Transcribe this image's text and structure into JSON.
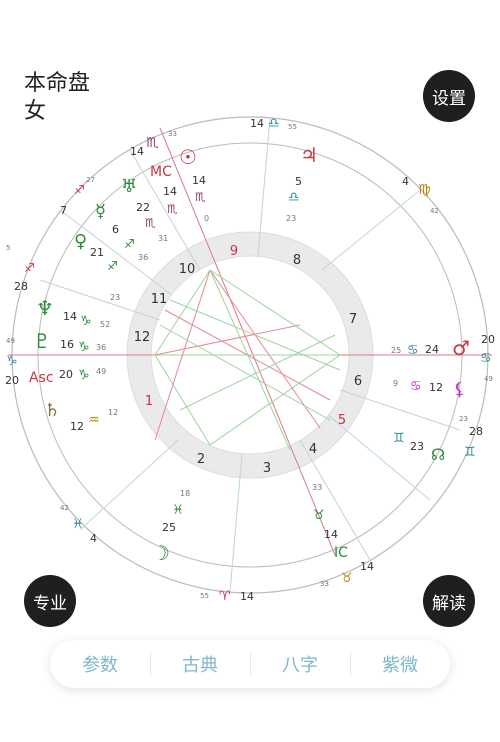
{
  "header": {
    "title": "本命盘",
    "gender": "女",
    "settings_label": "设置"
  },
  "footer_buttons": {
    "pro_label": "专业",
    "interpret_label": "解读"
  },
  "tabs": [
    "参数",
    "古典",
    "八字",
    "紫微"
  ],
  "houses": [
    "1",
    "2",
    "3",
    "4",
    "5",
    "6",
    "7",
    "8",
    "9",
    "10",
    "11",
    "12"
  ],
  "cusp_labels": [
    {
      "deg": "14",
      "min": "55",
      "sign": "♎"
    },
    {
      "deg": "4",
      "min": "42",
      "sign": "♍"
    },
    {
      "deg": "20",
      "min": "49",
      "sign": "♋"
    },
    {
      "deg": "28",
      "min": "23",
      "sign": "♊"
    },
    {
      "deg": "14",
      "min": "33",
      "sign": "♉"
    },
    {
      "deg": "14",
      "min": "55",
      "sign": "♈"
    },
    {
      "deg": "4",
      "min": "42",
      "sign": "♓"
    },
    {
      "deg": "20",
      "min": "49",
      "sign": "♑"
    },
    {
      "deg": "28",
      "min": "5",
      "sign": "♐"
    },
    {
      "deg": "14",
      "min": "27",
      "sign": "♐"
    },
    {
      "deg": "7",
      "min": "",
      "sign": ""
    },
    {
      "deg": "14",
      "min": "33",
      "sign": "♏"
    }
  ],
  "planets": [
    {
      "glyph": "☉",
      "deg": "14",
      "sign": "♏",
      "min": "0",
      "color": "#cc3344"
    },
    {
      "glyph": "MC",
      "deg": "14",
      "sign": "♏",
      "min": "33",
      "color": "#cc3344"
    },
    {
      "glyph": "♃",
      "deg": "5",
      "sign": "♎",
      "min": "23",
      "color": "#cc3344"
    },
    {
      "glyph": "♅",
      "deg": "22",
      "sign": "♏",
      "min": "31",
      "color": "#2a8a3a"
    },
    {
      "glyph": "☿",
      "deg": "6",
      "sign": "♐",
      "min": "36",
      "color": "#2a8a3a"
    },
    {
      "glyph": "♀",
      "deg": "21",
      "sign": "♐",
      "min": "23",
      "color": "#2a8a3a"
    },
    {
      "glyph": "♆",
      "deg": "14",
      "sign": "♑",
      "min": "52",
      "color": "#2a8a3a"
    },
    {
      "glyph": "♇",
      "deg": "16",
      "sign": "♑",
      "min": "36",
      "color": "#2a8a3a"
    },
    {
      "glyph": "Asc",
      "deg": "20",
      "sign": "♑",
      "min": "49",
      "color": "#cc3344"
    },
    {
      "glyph": "♄",
      "deg": "12",
      "sign": "♒",
      "min": "12",
      "color": "#8a6a3a"
    },
    {
      "glyph": "☽",
      "deg": "25",
      "sign": "♓",
      "min": "18",
      "color": "#2a8a3a"
    },
    {
      "glyph": "♂",
      "deg": "24",
      "sign": "♋",
      "min": "25",
      "color": "#cc3344"
    },
    {
      "glyph": "⚸",
      "deg": "12",
      "sign": "♋",
      "min": "9",
      "color": "#cc33cc"
    },
    {
      "glyph": "☊",
      "deg": "23",
      "sign": "♊",
      "min": "",
      "color": "#2a8a3a"
    },
    {
      "glyph": "IC",
      "deg": "14",
      "sign": "♉",
      "min": "33",
      "color": "#2a8a3a"
    }
  ],
  "colors": {
    "accent": "#7fb8cc",
    "red": "#cc3344",
    "green": "#2a8a3a",
    "teal": "#2a8a9a"
  }
}
